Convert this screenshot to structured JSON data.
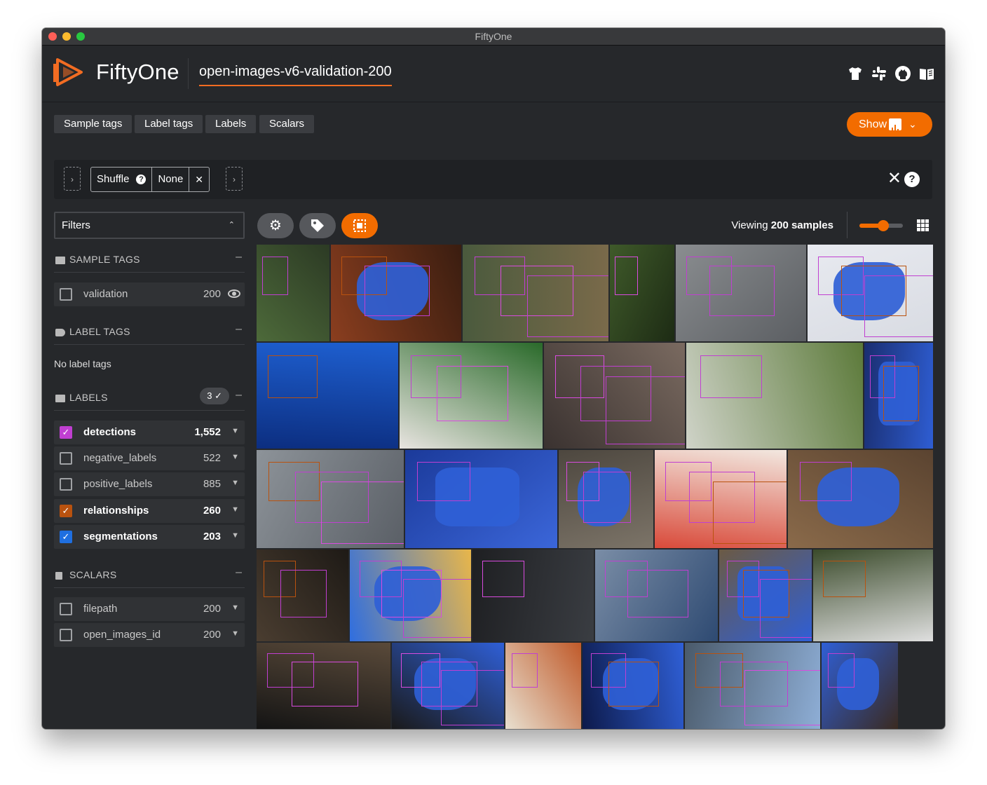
{
  "window": {
    "title": "FiftyOne"
  },
  "header": {
    "brand": "FiftyOne",
    "dataset_name": "open-images-v6-validation-200",
    "icons": [
      "tshirt-icon",
      "slack-icon",
      "github-icon",
      "docs-book-icon"
    ]
  },
  "tabs": [
    "Sample tags",
    "Label tags",
    "Labels",
    "Scalars"
  ],
  "show_button": {
    "label": "Show",
    "icon": "bar-chart-icon",
    "color": "#f26c00"
  },
  "view_bar": {
    "stages": [
      {
        "name": "Shuffle",
        "param": "None"
      }
    ],
    "add_stage_glyph": "›",
    "close_glyph": "✕",
    "help_glyph": "?"
  },
  "sidebar": {
    "filters_label": "Filters",
    "sample_tags": {
      "title": "SAMPLE TAGS",
      "items": [
        {
          "name": "validation",
          "count": "200"
        }
      ]
    },
    "label_tags": {
      "title": "LABEL TAGS",
      "empty_text": "No label tags"
    },
    "labels": {
      "title": "LABELS",
      "selected_count": "3 ✓",
      "items": [
        {
          "name": "detections",
          "count": "1,552",
          "checked": true,
          "color": "#c03fd1"
        },
        {
          "name": "negative_labels",
          "count": "522",
          "checked": false,
          "color": ""
        },
        {
          "name": "positive_labels",
          "count": "885",
          "checked": false,
          "color": ""
        },
        {
          "name": "relationships",
          "count": "260",
          "checked": true,
          "color": "#b9520f"
        },
        {
          "name": "segmentations",
          "count": "203",
          "checked": true,
          "color": "#1f6fe0"
        }
      ]
    },
    "scalars": {
      "title": "SCALARS",
      "items": [
        {
          "name": "filepath",
          "count": "200"
        },
        {
          "name": "open_images_id",
          "count": "200"
        }
      ]
    }
  },
  "grid": {
    "viewing_prefix": "Viewing",
    "viewing_count": "200 samples",
    "zoom_level": 0.55,
    "action_icons": [
      "settings-gear-icon",
      "tag-icon",
      "selection-patches-icon"
    ]
  },
  "colors": {
    "accent": "#f26c00",
    "background": "#26282b"
  },
  "gallery_images": [
    "plants",
    "blue cups on table",
    "coral reef with clownfish",
    "green leaves",
    "parked vintage cars",
    "blue jacket",
    "school of fish",
    "baby onesies",
    "two men at table",
    "green Jaguar sports car",
    "man in blue hat",
    "rainy car windshield",
    "blue keyboard screen",
    "dog on rocks",
    "plate of food",
    "blue seashell on sand",
    "bowls of spices",
    "woman with yellow cape",
    "presentation slide",
    "sinking ship",
    "blue starfish",
    "child on blue chair",
    "black cat",
    "hands on piano",
    "monk in orange robe",
    "synthesizer keyboard",
    "barbed wire",
    "blue vase with plant"
  ]
}
